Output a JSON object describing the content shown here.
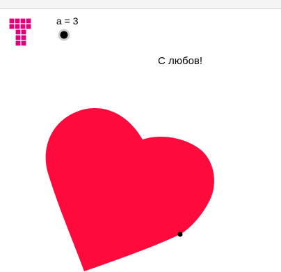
{
  "slider": {
    "label": "a = 3",
    "value": 3
  },
  "caption": "С любов!",
  "colors": {
    "heart": "#ff0a3c",
    "logo": "#e2007a",
    "point": "#000000"
  },
  "icons": {
    "logo": "geogebra-tube-logo-icon",
    "slider_knob": "slider-knob-icon"
  }
}
